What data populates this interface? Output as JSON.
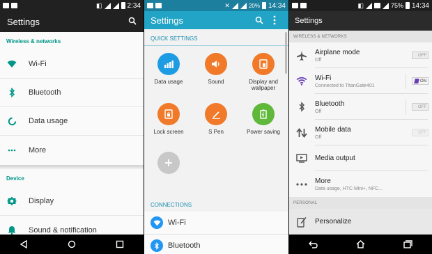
{
  "panel1": {
    "status_time": "2:34",
    "title": "Settings",
    "sections": [
      {
        "header": "Wireless & networks",
        "items": [
          {
            "label": "Wi-Fi",
            "icon": "wifi-icon"
          },
          {
            "label": "Bluetooth",
            "icon": "bluetooth-icon"
          },
          {
            "label": "Data usage",
            "icon": "data-usage-icon"
          },
          {
            "label": "More",
            "icon": "more-dots-icon"
          }
        ]
      },
      {
        "header": "Device",
        "items": [
          {
            "label": "Display",
            "icon": "display-brightness-icon"
          },
          {
            "label": "Sound & notification",
            "icon": "bell-icon"
          }
        ]
      }
    ],
    "accent": "#009688"
  },
  "panel2": {
    "status_battery": "20%",
    "status_time": "14:34",
    "title": "Settings",
    "quick_header": "QUICK SETTINGS",
    "tiles": [
      {
        "label": "Data usage",
        "color": "#1e9ce3"
      },
      {
        "label": "Sound",
        "color": "#f07a2a"
      },
      {
        "label": "Display and wallpaper",
        "color": "#f07a2a"
      },
      {
        "label": "Lock screen",
        "color": "#f07a2a"
      },
      {
        "label": "S Pen",
        "color": "#f07a2a"
      },
      {
        "label": "Power saving",
        "color": "#5fb83a"
      }
    ],
    "add_color": "#c8c8c8",
    "connections_header": "CONNECTIONS",
    "connections": [
      {
        "label": "Wi-Fi"
      },
      {
        "label": "Bluetooth"
      }
    ],
    "accent": "#22a4c6"
  },
  "panel3": {
    "status_battery": "75%",
    "status_time": "14:34",
    "title": "Settings",
    "wireless_header": "WIRELESS & NETWORKS",
    "rows": [
      {
        "label": "Airplane mode",
        "sub": "Off",
        "toggle": "OFF"
      },
      {
        "label": "Wi-Fi",
        "sub": "Connected to TitanGate401",
        "toggle": "ON"
      },
      {
        "label": "Bluetooth",
        "sub": "Off",
        "toggle": "OFF"
      },
      {
        "label": "Mobile data",
        "sub": "Off",
        "toggle": "OFF"
      },
      {
        "label": "Media output",
        "sub": ""
      },
      {
        "label": "More",
        "sub": "Data usage, HTC Mini+, NFC..."
      }
    ],
    "personal_header": "PERSONAL",
    "personalize": "Personalize",
    "accent": "#6a3fb8"
  }
}
